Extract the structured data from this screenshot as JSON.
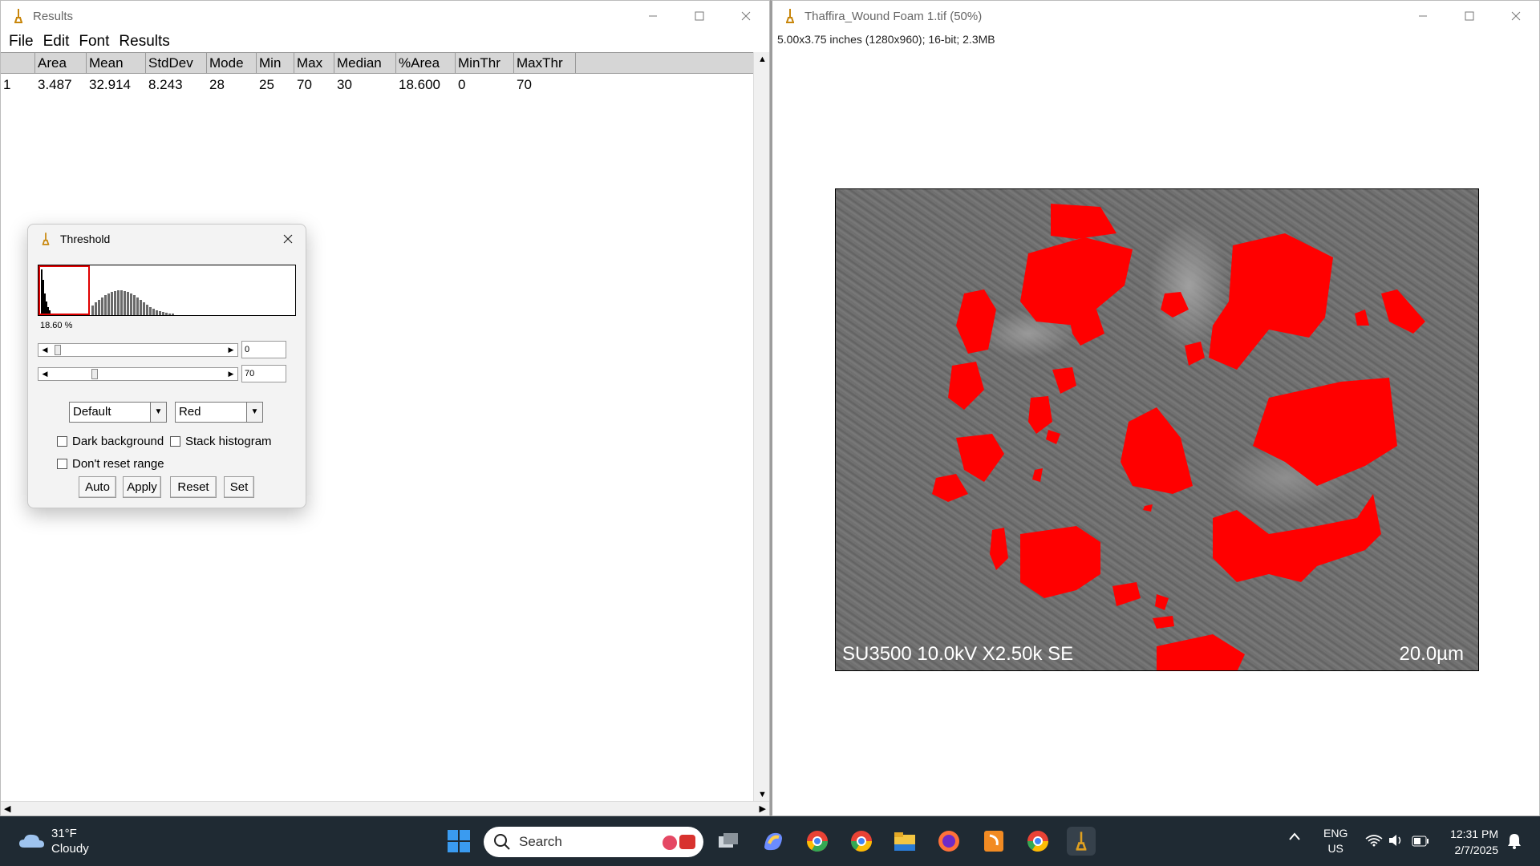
{
  "results_window": {
    "title": "Results",
    "menu": [
      "File",
      "Edit",
      "Font",
      "Results"
    ],
    "columns": [
      "",
      "Area",
      "Mean",
      "StdDev",
      "Mode",
      "Min",
      "Max",
      "Median",
      "%Area",
      "MinThr",
      "MaxThr"
    ],
    "rows": [
      [
        "1",
        "3.487",
        "32.914",
        "8.243",
        "28",
        "25",
        "70",
        "30",
        "18.600",
        "0",
        "70"
      ]
    ]
  },
  "image_window": {
    "title": "Thaffira_Wound Foam 1.tif (50%)",
    "info": "5.00x3.75 inches (1280x960); 16-bit; 2.3MB",
    "sem_label": "SU3500 10.0kV X2.50k SE",
    "scale_label": "20.0µm",
    "overlay_color": "#ff0000"
  },
  "threshold": {
    "title": "Threshold",
    "percent": "18.60 %",
    "min_value": "0",
    "max_value": "70",
    "method": "Default",
    "display": "Red",
    "dark_background": "Dark background",
    "stack_histogram": "Stack histogram",
    "dont_reset": "Don't reset range",
    "buttons": {
      "auto": "Auto",
      "apply": "Apply",
      "reset": "Reset",
      "set": "Set"
    },
    "selection_color": "#e00000"
  },
  "taskbar": {
    "weather_temp": "31°F",
    "weather_desc": "Cloudy",
    "search_placeholder": "Search",
    "lang": "ENG",
    "region": "US",
    "time": "12:31 PM",
    "date": "2/7/2025",
    "icons": [
      "start-icon",
      "task-view-icon",
      "copilot-icon",
      "chrome-dev-icon",
      "chrome-icon",
      "file-explorer-icon",
      "firefox-icon",
      "pdf-app-icon",
      "chrome-canary-icon",
      "imagej-icon"
    ]
  }
}
